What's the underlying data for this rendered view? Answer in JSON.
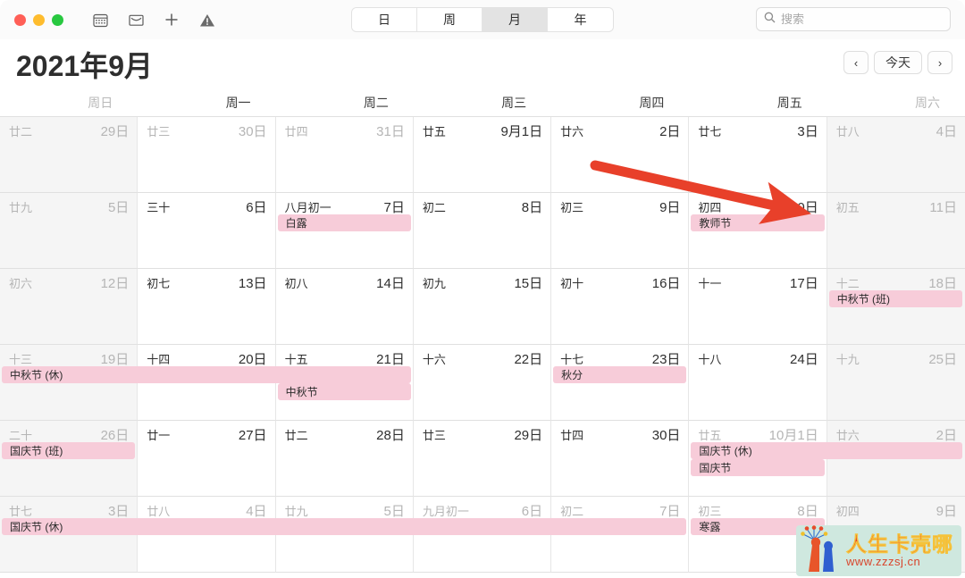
{
  "window": {
    "traffic_lights": [
      "close",
      "minimize",
      "zoom"
    ],
    "toolbar_icons": [
      "calendar-icon",
      "inbox-icon",
      "plus-icon",
      "warning-icon"
    ]
  },
  "segmented_control": {
    "options": [
      "日",
      "周",
      "月",
      "年"
    ],
    "selected": "月"
  },
  "search": {
    "placeholder": "搜索",
    "value": "",
    "icon": "search-icon"
  },
  "header": {
    "title": "2021年9月",
    "prev_label": "‹",
    "today_label": "今天",
    "next_label": "›"
  },
  "weekdays": [
    {
      "label": "周日",
      "weekend": true
    },
    {
      "label": "周一",
      "weekend": false
    },
    {
      "label": "周二",
      "weekend": false
    },
    {
      "label": "周三",
      "weekend": false
    },
    {
      "label": "周四",
      "weekend": false
    },
    {
      "label": "周五",
      "weekend": false
    },
    {
      "label": "周六",
      "weekend": true
    }
  ],
  "days": [
    {
      "lunar": "廿二",
      "solar": "29日",
      "dim": true,
      "weekend": true,
      "month_start": false
    },
    {
      "lunar": "廿三",
      "solar": "30日",
      "dim": true,
      "weekend": false,
      "month_start": false
    },
    {
      "lunar": "廿四",
      "solar": "31日",
      "dim": true,
      "weekend": false,
      "month_start": false
    },
    {
      "lunar": "廿五",
      "solar": "9月1日",
      "dim": false,
      "weekend": false,
      "month_start": false
    },
    {
      "lunar": "廿六",
      "solar": "2日",
      "dim": false,
      "weekend": false,
      "month_start": false
    },
    {
      "lunar": "廿七",
      "solar": "3日",
      "dim": false,
      "weekend": false,
      "month_start": false
    },
    {
      "lunar": "廿八",
      "solar": "4日",
      "dim": true,
      "weekend": true,
      "month_start": false
    },
    {
      "lunar": "廿九",
      "solar": "5日",
      "dim": true,
      "weekend": true,
      "month_start": false
    },
    {
      "lunar": "三十",
      "solar": "6日",
      "dim": false,
      "weekend": false,
      "month_start": false
    },
    {
      "lunar": "八月初一",
      "solar": "7日",
      "dim": false,
      "weekend": false,
      "month_start": true
    },
    {
      "lunar": "初二",
      "solar": "8日",
      "dim": false,
      "weekend": false,
      "month_start": false
    },
    {
      "lunar": "初三",
      "solar": "9日",
      "dim": false,
      "weekend": false,
      "month_start": false
    },
    {
      "lunar": "初四",
      "solar": "10日",
      "dim": false,
      "weekend": false,
      "month_start": false
    },
    {
      "lunar": "初五",
      "solar": "11日",
      "dim": true,
      "weekend": true,
      "month_start": false
    },
    {
      "lunar": "初六",
      "solar": "12日",
      "dim": true,
      "weekend": true,
      "month_start": false
    },
    {
      "lunar": "初七",
      "solar": "13日",
      "dim": false,
      "weekend": false,
      "month_start": false
    },
    {
      "lunar": "初八",
      "solar": "14日",
      "dim": false,
      "weekend": false,
      "month_start": false
    },
    {
      "lunar": "初九",
      "solar": "15日",
      "dim": false,
      "weekend": false,
      "month_start": false
    },
    {
      "lunar": "初十",
      "solar": "16日",
      "dim": false,
      "weekend": false,
      "month_start": false
    },
    {
      "lunar": "十一",
      "solar": "17日",
      "dim": false,
      "weekend": false,
      "month_start": false
    },
    {
      "lunar": "十二",
      "solar": "18日",
      "dim": true,
      "weekend": true,
      "month_start": false
    },
    {
      "lunar": "十三",
      "solar": "19日",
      "dim": true,
      "weekend": true,
      "month_start": false
    },
    {
      "lunar": "十四",
      "solar": "20日",
      "dim": false,
      "weekend": false,
      "month_start": false
    },
    {
      "lunar": "十五",
      "solar": "21日",
      "dim": false,
      "weekend": false,
      "month_start": false
    },
    {
      "lunar": "十六",
      "solar": "22日",
      "dim": false,
      "weekend": false,
      "month_start": false
    },
    {
      "lunar": "十七",
      "solar": "23日",
      "dim": false,
      "weekend": false,
      "month_start": false
    },
    {
      "lunar": "十八",
      "solar": "24日",
      "dim": false,
      "weekend": false,
      "month_start": false
    },
    {
      "lunar": "十九",
      "solar": "25日",
      "dim": true,
      "weekend": true,
      "month_start": false
    },
    {
      "lunar": "二十",
      "solar": "26日",
      "dim": true,
      "weekend": true,
      "month_start": false
    },
    {
      "lunar": "廿一",
      "solar": "27日",
      "dim": false,
      "weekend": false,
      "month_start": false
    },
    {
      "lunar": "廿二",
      "solar": "28日",
      "dim": false,
      "weekend": false,
      "month_start": false
    },
    {
      "lunar": "廿三",
      "solar": "29日",
      "dim": false,
      "weekend": false,
      "month_start": false
    },
    {
      "lunar": "廿四",
      "solar": "30日",
      "dim": false,
      "weekend": false,
      "month_start": false
    },
    {
      "lunar": "廿五",
      "solar": "10月1日",
      "dim": true,
      "weekend": false,
      "month_start": false
    },
    {
      "lunar": "廿六",
      "solar": "2日",
      "dim": true,
      "weekend": true,
      "month_start": false
    },
    {
      "lunar": "廿七",
      "solar": "3日",
      "dim": true,
      "weekend": true,
      "month_start": false
    },
    {
      "lunar": "廿八",
      "solar": "4日",
      "dim": true,
      "weekend": false,
      "month_start": false
    },
    {
      "lunar": "廿九",
      "solar": "5日",
      "dim": true,
      "weekend": false,
      "month_start": false
    },
    {
      "lunar": "九月初一",
      "solar": "6日",
      "dim": true,
      "weekend": false,
      "month_start": true
    },
    {
      "lunar": "初二",
      "solar": "7日",
      "dim": true,
      "weekend": false,
      "month_start": false
    },
    {
      "lunar": "初三",
      "solar": "8日",
      "dim": true,
      "weekend": false,
      "month_start": false
    },
    {
      "lunar": "初四",
      "solar": "9日",
      "dim": true,
      "weekend": true,
      "month_start": false
    }
  ],
  "events": [
    {
      "title": "白露",
      "week": 1,
      "col": 2,
      "span": 1,
      "lane": 0
    },
    {
      "title": "教师节",
      "week": 1,
      "col": 5,
      "span": 1,
      "lane": 0
    },
    {
      "title": "中秋节 (班)",
      "week": 2,
      "col": 6,
      "span": 1,
      "lane": 0
    },
    {
      "title": "中秋节 (休)",
      "week": 3,
      "col": 0,
      "span": 3,
      "lane": 0
    },
    {
      "title": "中秋节",
      "week": 3,
      "col": 2,
      "span": 1,
      "lane": 1
    },
    {
      "title": "秋分",
      "week": 3,
      "col": 4,
      "span": 1,
      "lane": 0
    },
    {
      "title": "国庆节 (班)",
      "week": 4,
      "col": 0,
      "span": 1,
      "lane": 0
    },
    {
      "title": "国庆节 (休)",
      "week": 4,
      "col": 5,
      "span": 2,
      "lane": 0
    },
    {
      "title": "国庆节",
      "week": 4,
      "col": 5,
      "span": 1,
      "lane": 1
    },
    {
      "title": "国庆节 (休)",
      "week": 5,
      "col": 0,
      "span": 5,
      "lane": 0
    },
    {
      "title": "寒露",
      "week": 5,
      "col": 5,
      "span": 1,
      "lane": 0
    }
  ],
  "annotation": {
    "type": "arrow",
    "color": "#e8402a",
    "points_at": "10日"
  },
  "watermark": {
    "title": "人生卡壳哪",
    "url": "www.zzzsj.cn"
  },
  "colors": {
    "event_bg": "#f7ccd9",
    "weekend_bg": "#f5f5f5",
    "accent_red": "#e8503a",
    "arrow": "#e8402a"
  }
}
